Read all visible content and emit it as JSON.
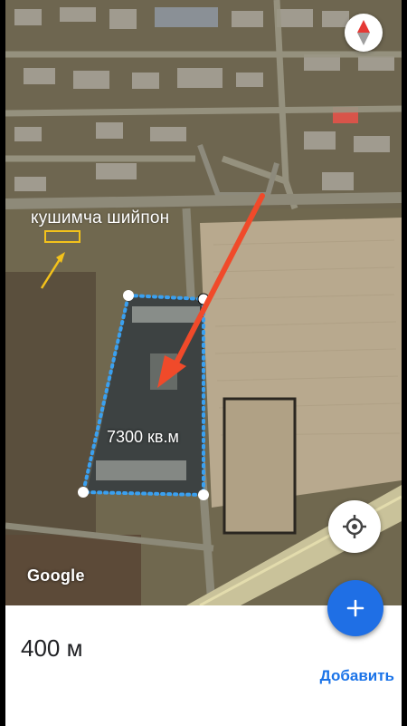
{
  "map": {
    "annotation_label": "кушимча шийпон",
    "area_label": "7300 кв.м",
    "attribution": "Google",
    "compass_icon": "compass-icon",
    "locate_icon": "my-location-icon",
    "arrow_color": "#f04a2a",
    "measure_line_color": "#3aa0f0"
  },
  "fab": {
    "icon": "plus-icon",
    "color": "#1f6fe5"
  },
  "bottom_sheet": {
    "distance": "400 м",
    "add_label": "Добавить"
  }
}
